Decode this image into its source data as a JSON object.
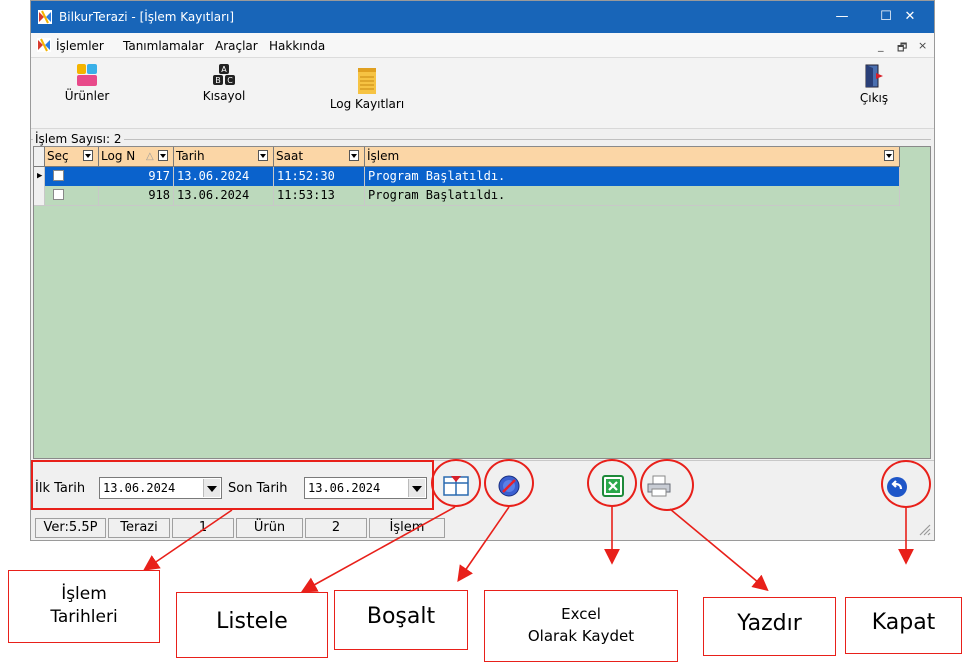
{
  "window": {
    "title": "BilkurTerazi  - [İşlem Kayıtları]",
    "controls": {
      "minimize": "—",
      "maximize": "☐",
      "close": "✕"
    }
  },
  "menu": {
    "items": [
      "İşlemler",
      "Tanımlamalar",
      "Araçlar",
      "Hakkında"
    ],
    "mdi_controls": [
      "_",
      "🗗",
      "×"
    ]
  },
  "toolbar": {
    "buttons": [
      {
        "label": "Ürünler",
        "icon": "products-icon"
      },
      {
        "label": "Kısayol",
        "icon": "shortcut-abc-icon"
      },
      {
        "label": "Log Kayıtları",
        "icon": "log-book-icon"
      },
      {
        "label": "Çıkış",
        "icon": "exit-door-icon"
      }
    ]
  },
  "group": {
    "label": "İşlem Sayısı: 2"
  },
  "grid": {
    "columns": [
      "Seç",
      "Log N",
      "Tarih",
      "Saat",
      "İşlem"
    ],
    "rows": [
      {
        "log_no": "917",
        "date": "13.06.2024",
        "time": "11:52:30",
        "action": "Program Başlatıldı.",
        "selected": true
      },
      {
        "log_no": "918",
        "date": "13.06.2024",
        "time": "11:53:13",
        "action": "Program Başlatıldı.",
        "selected": false
      }
    ]
  },
  "filter": {
    "start_label": "İlk Tarih",
    "start_value": "13.06.2024",
    "end_label": "Son Tarih",
    "end_value": "13.06.2024"
  },
  "statusbar": {
    "panels": [
      "Ver:5.5P",
      "Terazi",
      "1",
      "Ürün",
      "2",
      "İşlem"
    ]
  },
  "annotations": {
    "dates": "İşlem\nTarihleri",
    "list": "Listele",
    "clear": "Boşalt",
    "excel": "Excel\nOlarak Kaydet",
    "print": "Yazdır",
    "close": "Kapat"
  },
  "colors": {
    "titlebar": "#1865b8",
    "grid_bg": "#bcd9bc",
    "header_bg": "#fbd6a6",
    "selected_row": "#0a62cc",
    "annotation_red": "#e8201a"
  }
}
